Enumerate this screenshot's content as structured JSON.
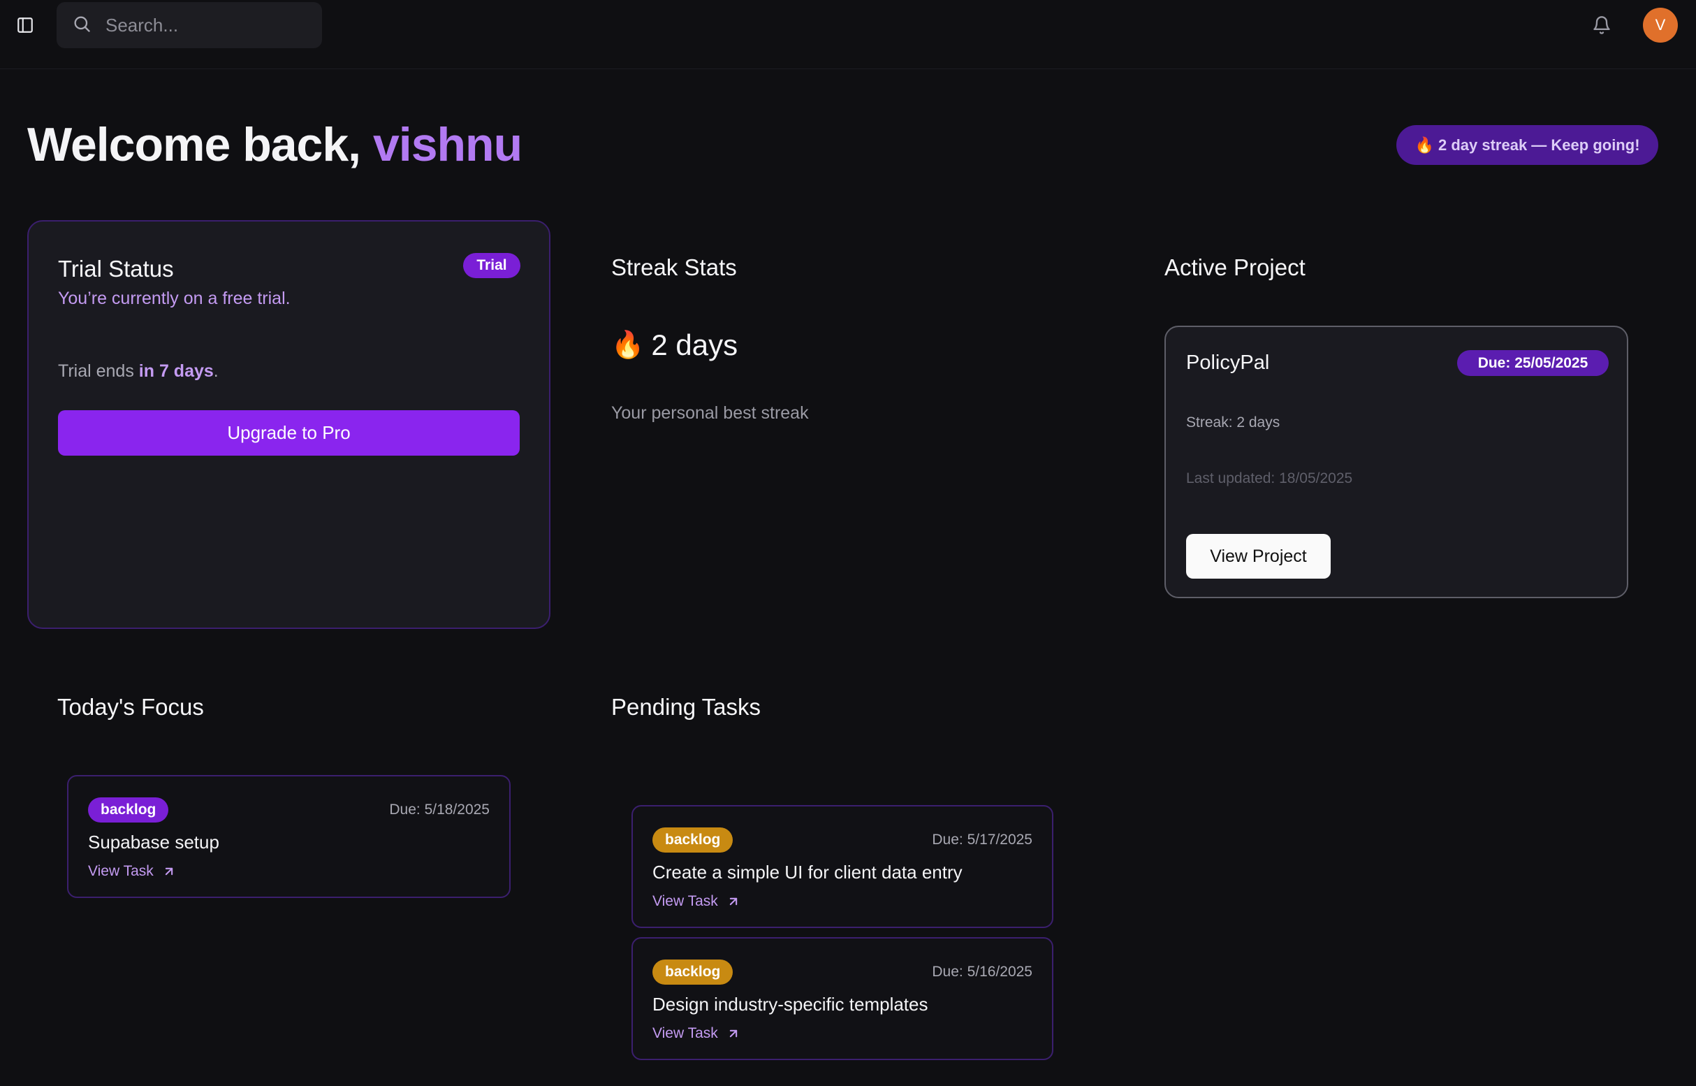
{
  "colors": {
    "background": "#0f0f12",
    "accent": "#8a25ee",
    "accent_text": "#b27af2",
    "focus_badge": "#7a1fd6",
    "pending_badge": "#c88a12",
    "avatar": "#e0702b"
  },
  "topbar": {
    "sidebar_icon": "sidebar-toggle-icon",
    "search_icon": "search-icon",
    "search_placeholder": "Search...",
    "search_value": "",
    "bell_icon": "bell-icon",
    "avatar_initial": "V"
  },
  "header": {
    "greeting": "Welcome back,",
    "username": "vishnu",
    "streak_pill": "🔥 2 day streak — Keep going!"
  },
  "trial": {
    "title": "Trial Status",
    "badge": "Trial",
    "subtitle": "You’re currently on a free trial.",
    "ends_prefix": "Trial ends ",
    "ends_value": "in 7 days",
    "ends_suffix": ".",
    "upgrade_label": "Upgrade to Pro"
  },
  "streak": {
    "title": "Streak Stats",
    "icon": "🔥",
    "value": "2 days",
    "caption": "Your personal best streak"
  },
  "active_project": {
    "title": "Active Project",
    "name": "PolicyPal",
    "due": "Due: 25/05/2025",
    "streak": "Streak: 2 days",
    "last_updated": "Last updated: 18/05/2025",
    "view_label": "View Project"
  },
  "focus": {
    "title": "Today's Focus",
    "tasks": [
      {
        "badge": "backlog",
        "due": "Due: 5/18/2025",
        "title": "Supabase setup",
        "link": "View Task"
      }
    ]
  },
  "pending": {
    "title": "Pending Tasks",
    "tasks": [
      {
        "badge": "backlog",
        "due": "Due: 5/17/2025",
        "title": "Create a simple UI for client data entry",
        "link": "View Task"
      },
      {
        "badge": "backlog",
        "due": "Due: 5/16/2025",
        "title": "Design industry-specific templates",
        "link": "View Task"
      }
    ]
  }
}
